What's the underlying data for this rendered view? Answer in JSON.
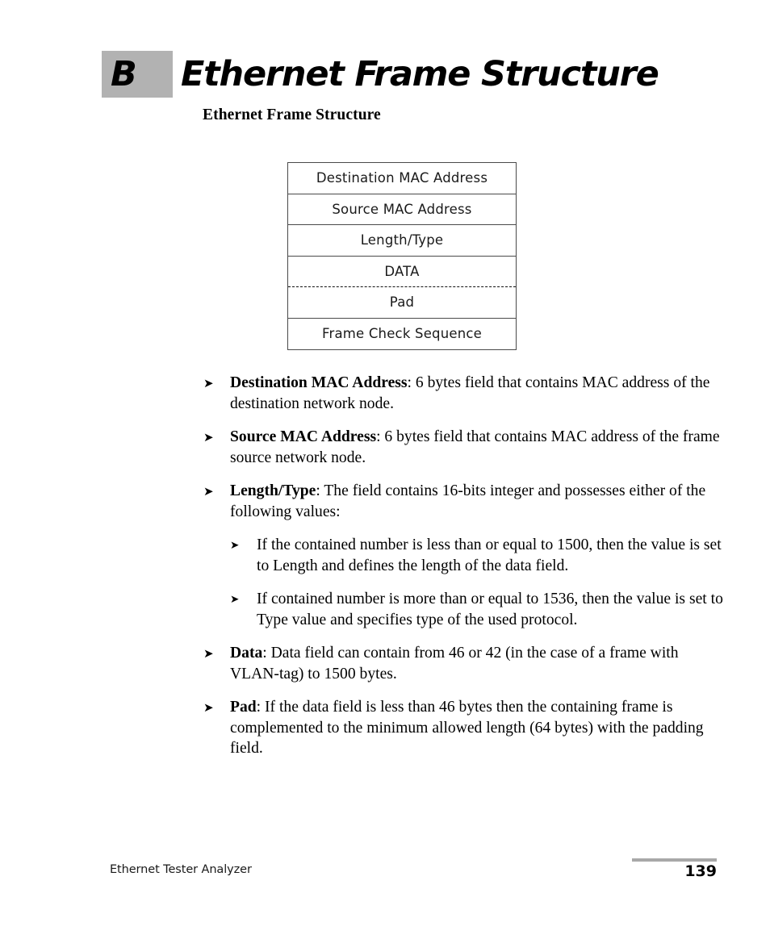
{
  "chapter": {
    "letter": "B",
    "title": "Ethernet Frame Structure"
  },
  "section": {
    "subtitle": "Ethernet Frame Structure"
  },
  "diagram": {
    "name": "ethernet-frame-structure-diagram",
    "rows": [
      {
        "label": "Destination MAC Address",
        "separator": "solid"
      },
      {
        "label": "Source MAC Address",
        "separator": "solid"
      },
      {
        "label": "Length/Type",
        "separator": "solid"
      },
      {
        "label": "DATA",
        "separator": "dashed"
      },
      {
        "label": "Pad",
        "separator": "solid"
      },
      {
        "label": "Frame Check Sequence",
        "separator": "none"
      }
    ]
  },
  "bullets": {
    "arrow_glyph": "➤",
    "items": [
      {
        "term": "Destination MAC Address",
        "text": ": 6 bytes field that contains MAC address of the destination network node."
      },
      {
        "term": "Source MAC Address",
        "text": ": 6 bytes field that contains MAC address of the frame source network node."
      },
      {
        "term": "Length/Type",
        "text": ": The field contains 16-bits integer and possesses either of the following values:"
      },
      {
        "term": "",
        "text": "If the contained number is less than or equal to 1500, then the value is set to Length and defines the length of the data field."
      },
      {
        "term": "",
        "text": "If contained number is more than or equal to 1536, then the value is set to Type value and specifies type of the used protocol."
      },
      {
        "term": "Data",
        "text": ": Data field can contain from 46 or 42 (in the case of a frame with VLAN-tag) to 1500 bytes."
      },
      {
        "term": "Pad",
        "text": ": If the data field is less than 46 bytes then the containing frame is complemented to the minimum allowed length (64 bytes) with the padding field."
      }
    ]
  },
  "footer": {
    "product": "Ethernet Tester Analyzer",
    "page_number": "139"
  }
}
